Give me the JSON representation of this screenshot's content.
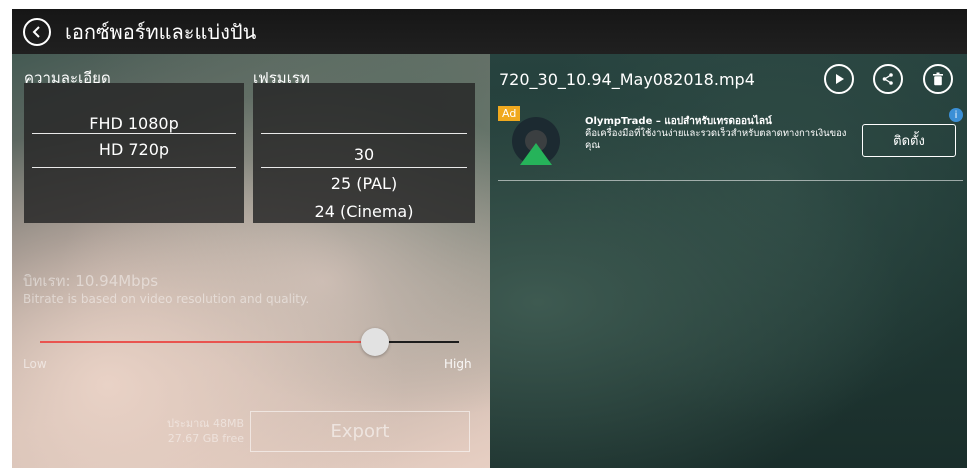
{
  "header": {
    "title": "เอกซ์พอร์ทและแบ่งปัน",
    "back_icon": "back-circle-icon"
  },
  "resolution": {
    "label": "ความละเอียด",
    "options": [
      "FHD 1080p",
      "HD 720p"
    ],
    "selected": "HD 720p"
  },
  "framerate": {
    "label": "เฟรมเรท",
    "options": [
      "30",
      "25 (PAL)",
      "24 (Cinema)"
    ],
    "selected": "30"
  },
  "bitrate": {
    "label": "บิทเรท: 10.94Mbps",
    "description": "Bitrate is based on video resolution and quality.",
    "low_label": "Low",
    "high_label": "High",
    "level": 0.82
  },
  "export": {
    "size_estimate": "ประมาณ 48MB",
    "free_space": "27.67 GB free",
    "button_label": "Export"
  },
  "file": {
    "name": "720_30_10.94_May082018.mp4",
    "icons": [
      "play-icon",
      "share-icon",
      "delete-icon"
    ]
  },
  "ad": {
    "badge": "Ad",
    "title": "OlympTrade – แอปสำหรับเทรดออนไลน์",
    "description": "คือเครื่องมือที่ใช้งานง่ายและรวดเร็วสำหรับตลาดทางการเงินของคุณ",
    "install_label": "ติดตั้ง",
    "info_icon": "info-icon"
  },
  "colors": {
    "slider_fill": "#e9544f",
    "ad_badge": "#f0a91f",
    "ad_info": "#3b8fd6"
  }
}
